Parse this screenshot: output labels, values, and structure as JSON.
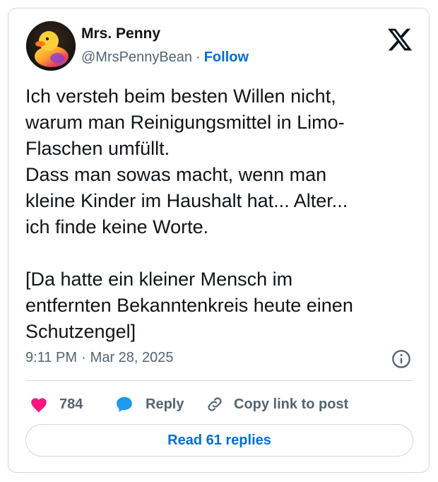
{
  "author": {
    "name": "Mrs. Penny",
    "handle": "@MrsPennyBean",
    "separator": "·",
    "follow_label": "Follow",
    "avatar_icon": "rubber-duck-avatar"
  },
  "brand": {
    "logo_icon": "x-logo-icon"
  },
  "tweet": {
    "text": "Ich versteh beim besten Willen nicht,\nwarum man Reinigungsmittel in Limo-\nFlaschen umfüllt.\nDass man sowas macht, wenn man\nkleine Kinder im Haushalt hat... Alter...\nich finde keine Worte.\n\n[Da hatte ein kleiner Mensch im\nentfernten Bekanntenkreis heute einen\nSchutzengel]",
    "time": "9:11 PM",
    "separator": "·",
    "date": "Mar 28, 2025"
  },
  "actions": {
    "like_count": "784",
    "reply_label": "Reply",
    "copy_label": "Copy link to post"
  },
  "read_replies_label": "Read 61 replies",
  "colors": {
    "accent": "#006fd6",
    "like": "#f91880",
    "reply_icon": "#1d9bf0",
    "muted": "#536471",
    "border": "#cfd9de"
  }
}
